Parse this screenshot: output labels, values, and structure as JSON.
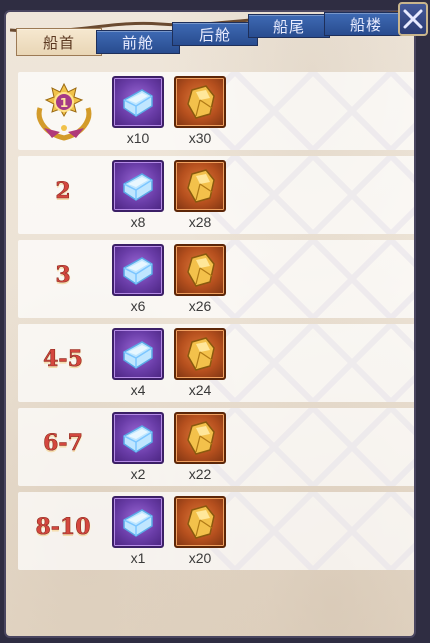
{
  "tabs": [
    {
      "label": "船首",
      "active": true
    },
    {
      "label": "前舱",
      "active": false
    },
    {
      "label": "后舱",
      "active": false
    },
    {
      "label": "船尾",
      "active": false
    },
    {
      "label": "船楼",
      "active": false
    }
  ],
  "medal_rank": "1",
  "rows": [
    {
      "rank": "",
      "medal": true,
      "item1_qty": "x10",
      "item2_qty": "x30"
    },
    {
      "rank": "2",
      "medal": false,
      "item1_qty": "x8",
      "item2_qty": "x28"
    },
    {
      "rank": "3",
      "medal": false,
      "item1_qty": "x6",
      "item2_qty": "x26"
    },
    {
      "rank": "4-5",
      "medal": false,
      "item1_qty": "x4",
      "item2_qty": "x24"
    },
    {
      "rank": "6-7",
      "medal": false,
      "item1_qty": "x2",
      "item2_qty": "x22"
    },
    {
      "rank": "8-10",
      "medal": false,
      "item1_qty": "x1",
      "item2_qty": "x20"
    }
  ],
  "items": {
    "item1_icon": "blue-crystal-ingot-icon",
    "item2_icon": "gold-ore-icon"
  },
  "colors": {
    "rank_text": "#d4473e",
    "tab_blue": "#294c8f",
    "tab_active": "#f6e8d0",
    "item_purple": "#6a3da8",
    "item_orange": "#b6501e"
  }
}
